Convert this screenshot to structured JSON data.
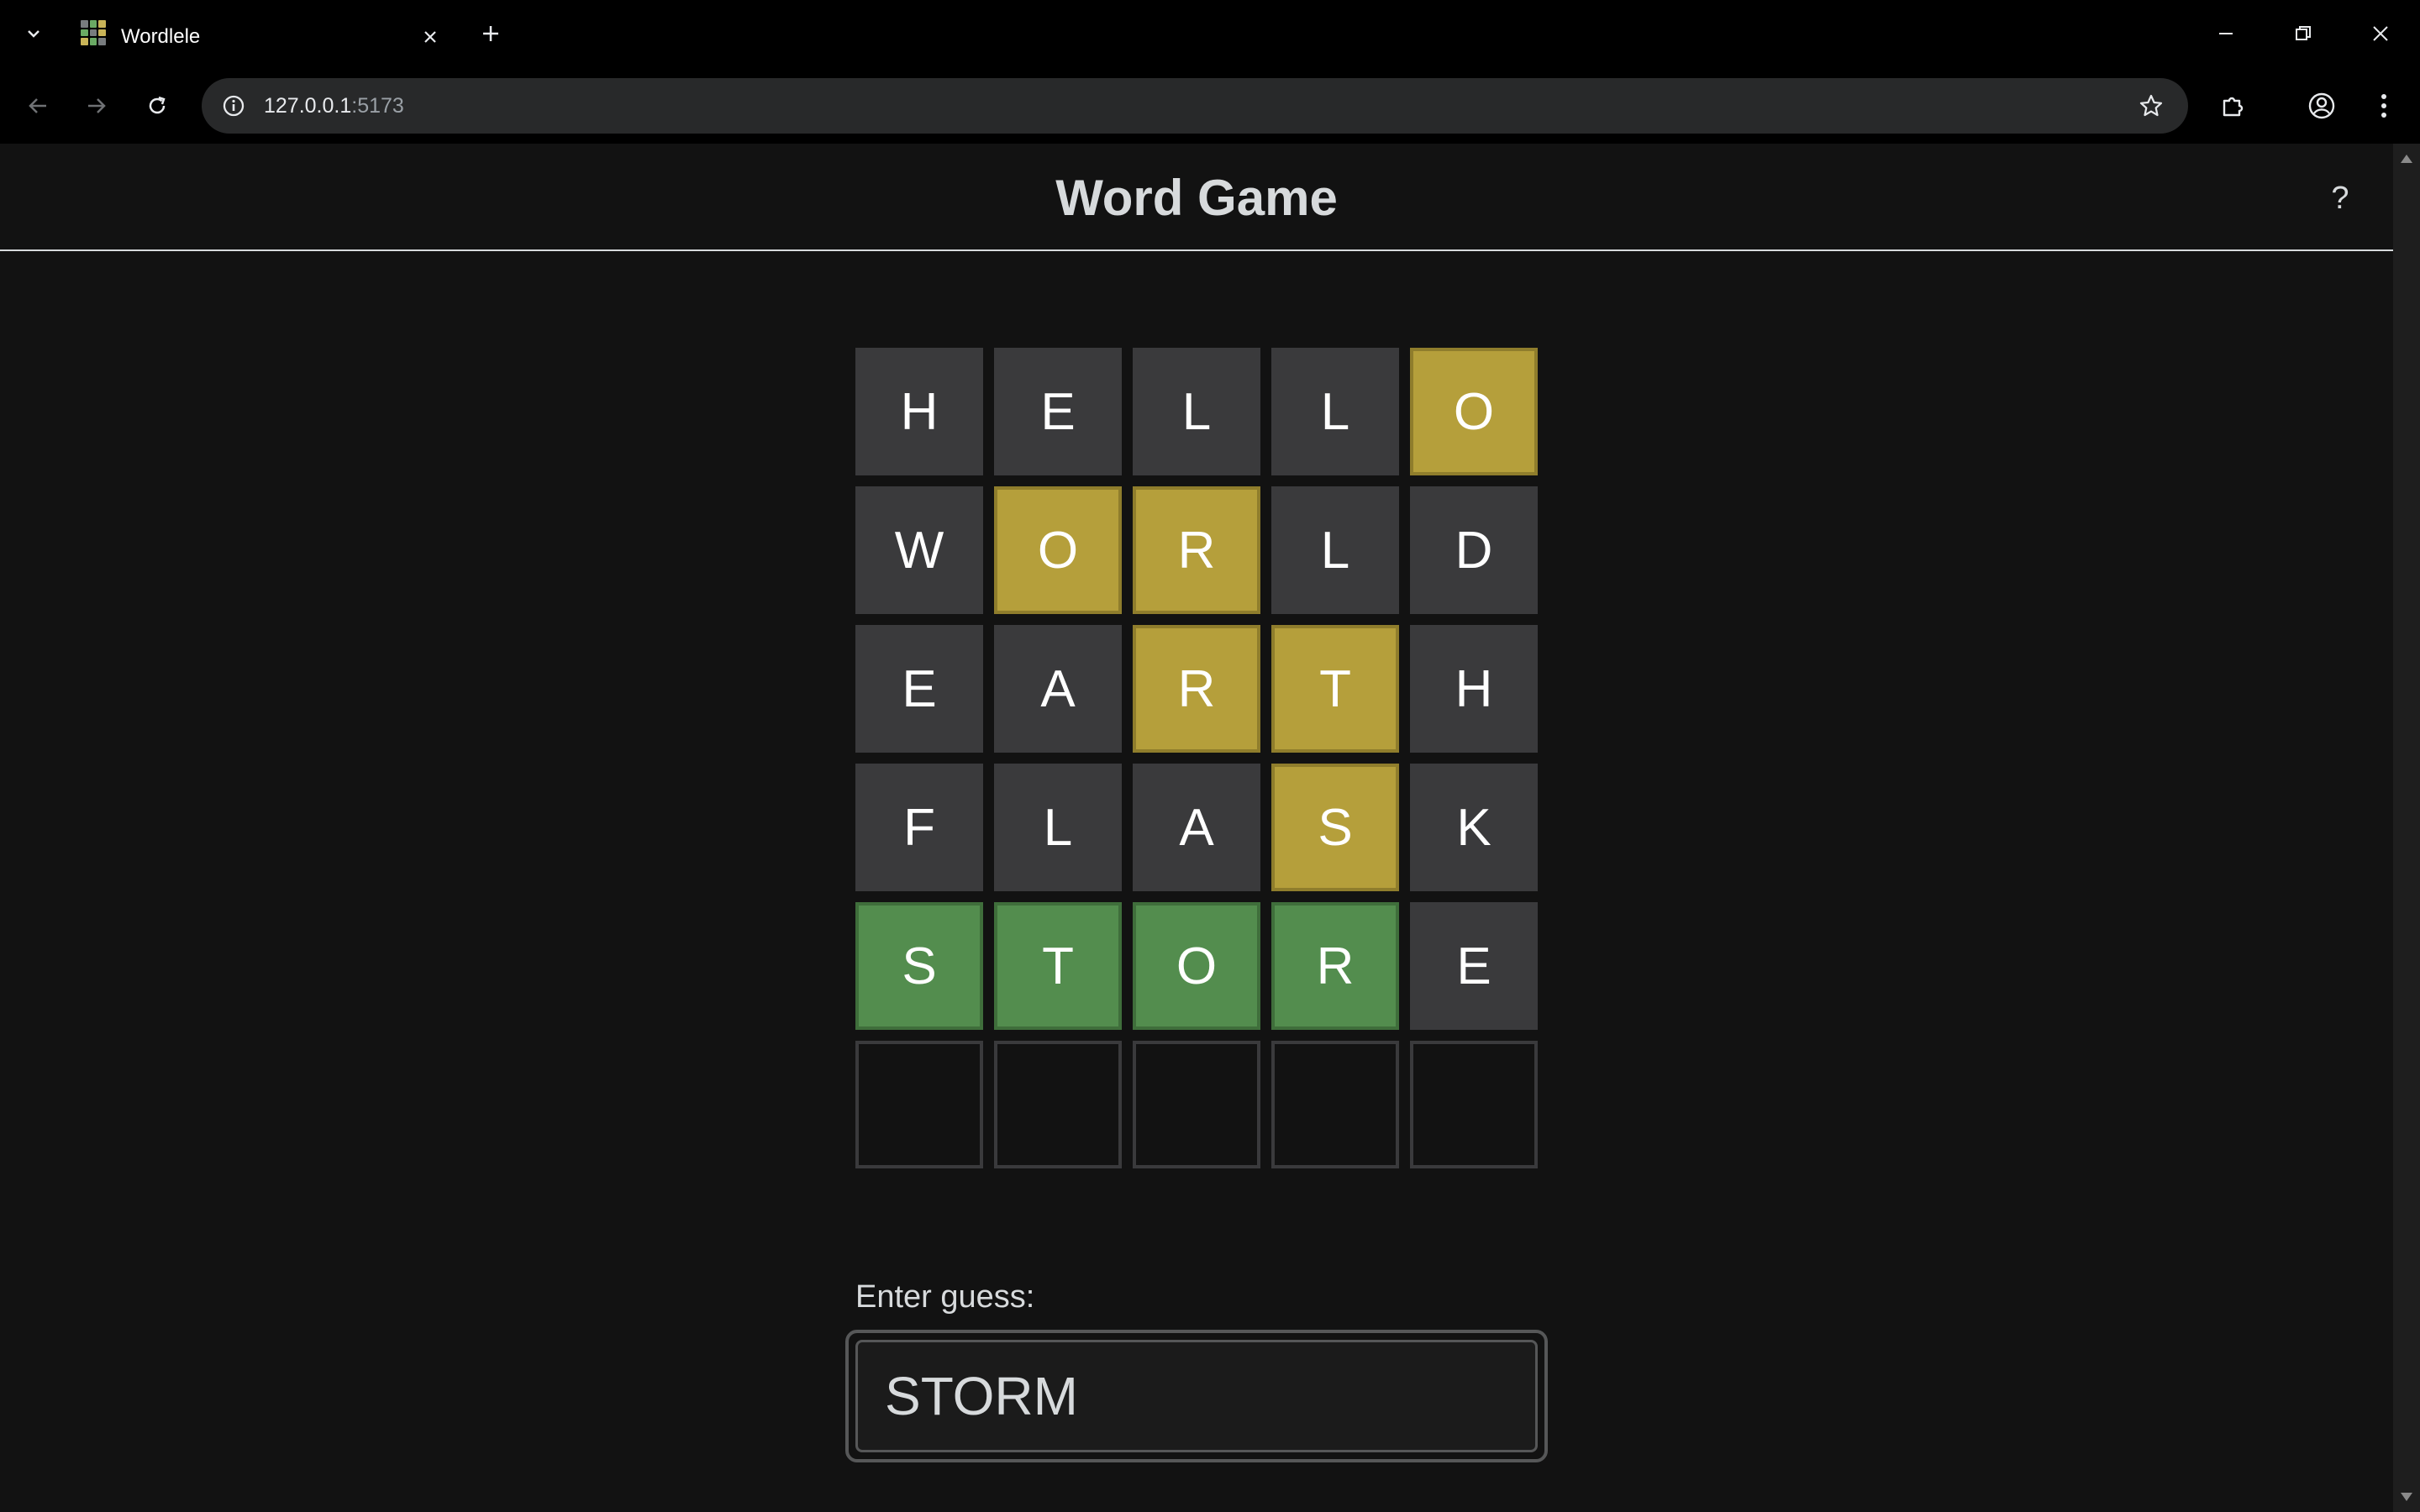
{
  "browser": {
    "tab_title": "Wordlele",
    "url_host": "127.0.0.1",
    "url_port": ":5173"
  },
  "header": {
    "title": "Word Game",
    "help_label": "?"
  },
  "board": {
    "rows": [
      [
        {
          "letter": "H",
          "state": "absent"
        },
        {
          "letter": "E",
          "state": "absent"
        },
        {
          "letter": "L",
          "state": "absent"
        },
        {
          "letter": "L",
          "state": "absent"
        },
        {
          "letter": "O",
          "state": "present"
        }
      ],
      [
        {
          "letter": "W",
          "state": "absent"
        },
        {
          "letter": "O",
          "state": "present"
        },
        {
          "letter": "R",
          "state": "present"
        },
        {
          "letter": "L",
          "state": "absent"
        },
        {
          "letter": "D",
          "state": "absent"
        }
      ],
      [
        {
          "letter": "E",
          "state": "absent"
        },
        {
          "letter": "A",
          "state": "absent"
        },
        {
          "letter": "R",
          "state": "present"
        },
        {
          "letter": "T",
          "state": "present"
        },
        {
          "letter": "H",
          "state": "absent"
        }
      ],
      [
        {
          "letter": "F",
          "state": "absent"
        },
        {
          "letter": "L",
          "state": "absent"
        },
        {
          "letter": "A",
          "state": "absent"
        },
        {
          "letter": "S",
          "state": "present"
        },
        {
          "letter": "K",
          "state": "absent"
        }
      ],
      [
        {
          "letter": "S",
          "state": "correct"
        },
        {
          "letter": "T",
          "state": "correct"
        },
        {
          "letter": "O",
          "state": "correct"
        },
        {
          "letter": "R",
          "state": "correct"
        },
        {
          "letter": "E",
          "state": "absent"
        }
      ],
      [
        {
          "letter": "",
          "state": "empty"
        },
        {
          "letter": "",
          "state": "empty"
        },
        {
          "letter": "",
          "state": "empty"
        },
        {
          "letter": "",
          "state": "empty"
        },
        {
          "letter": "",
          "state": "empty"
        }
      ]
    ]
  },
  "guess": {
    "label": "Enter guess:",
    "value": "STORM"
  },
  "colors": {
    "absent": "#3a3a3c",
    "present": "#b59f3b",
    "correct": "#538d4e",
    "background": "#121212"
  }
}
